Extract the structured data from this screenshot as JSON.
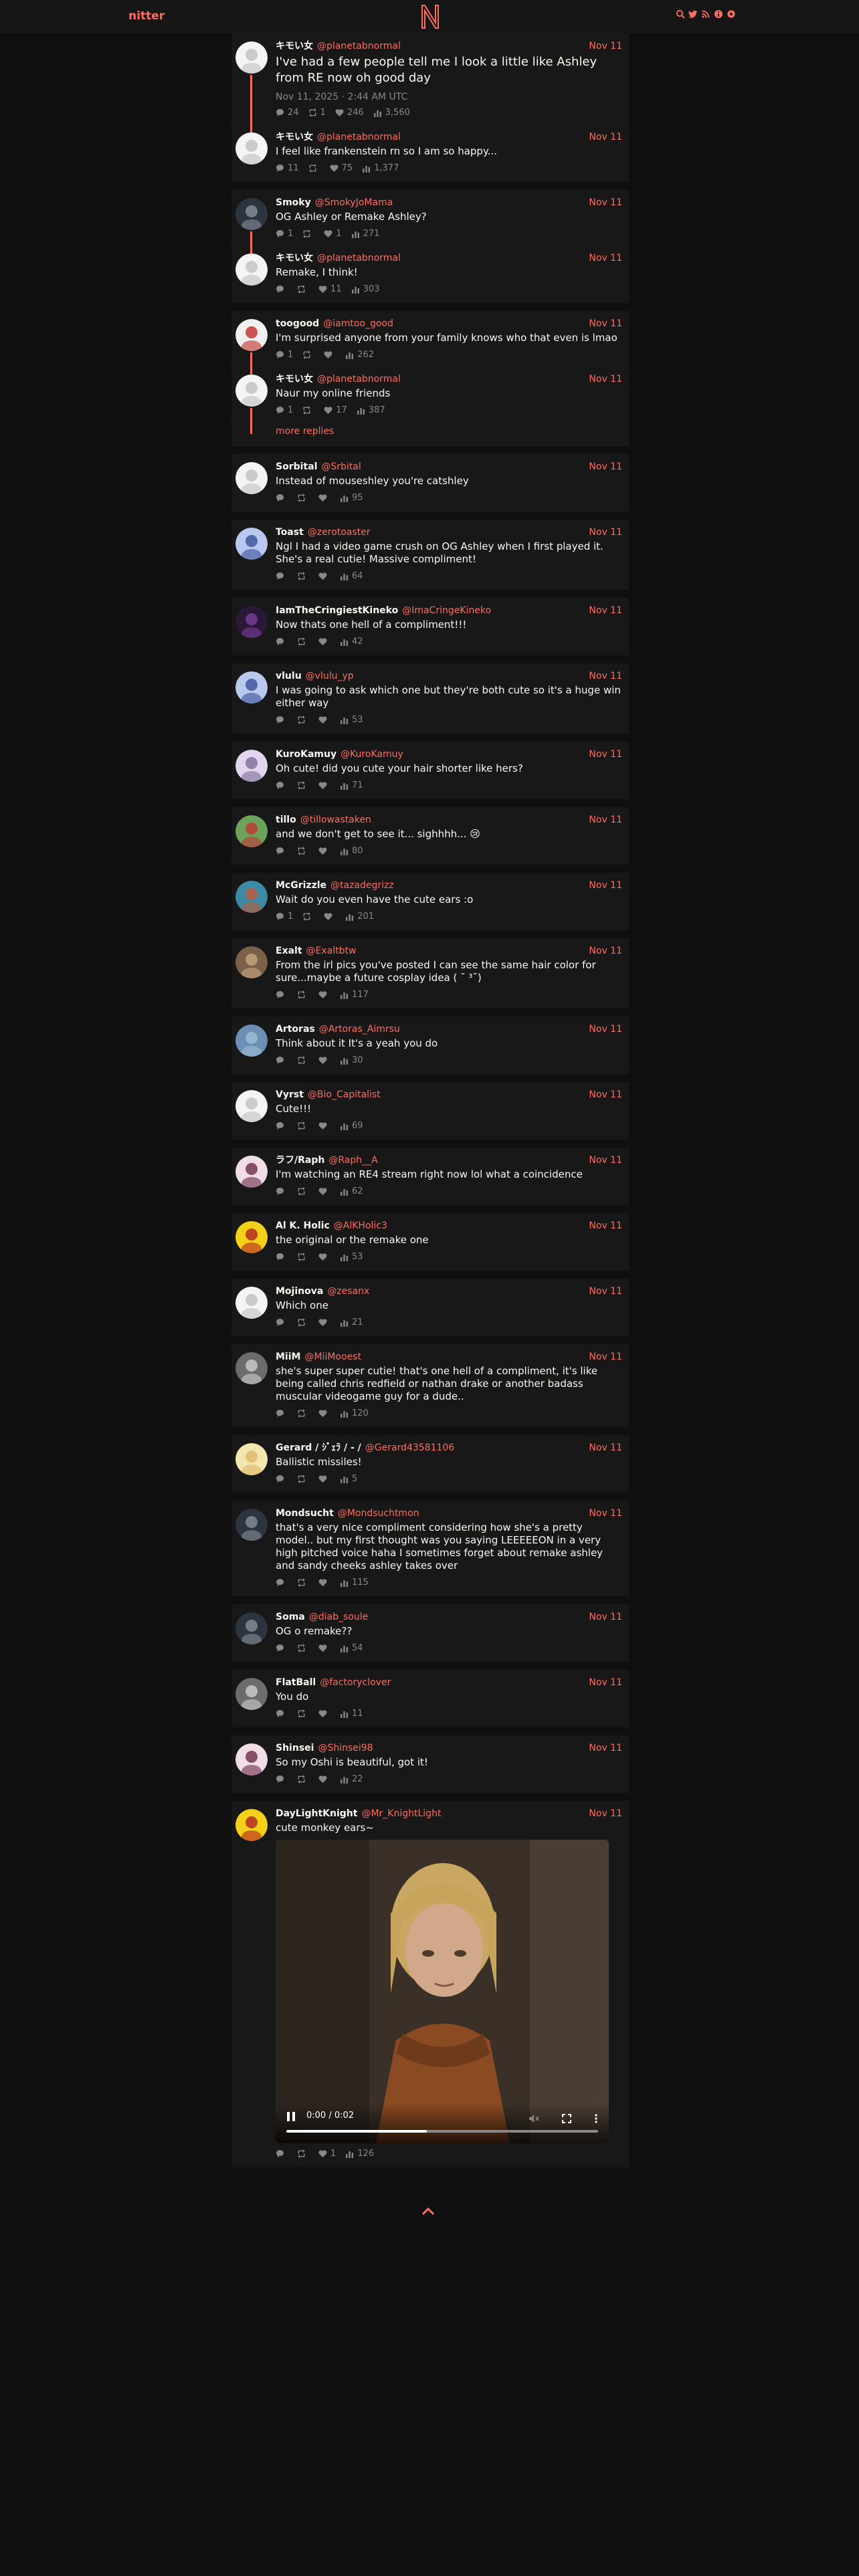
{
  "nav": {
    "brand": "nitter"
  },
  "colors": {
    "accent": "#ff6c60",
    "bg": "#0f0f0f",
    "card": "#181818",
    "muted": "#888888"
  },
  "threads": [
    {
      "tweets": [
        {
          "fullname": "キモい女",
          "username": "@planetabnormal",
          "date": "Nov 11",
          "content": "I've had a few people tell me I look a little like Ashley from RE now oh good day",
          "timestamp": "Nov 11, 2025 · 2:44 AM UTC",
          "replies": "24",
          "retweets": "1",
          "likes": "246",
          "views": "3,560",
          "avatar": "white-avatar"
        },
        {
          "fullname": "キモい女",
          "username": "@planetabnormal",
          "date": "Nov 11",
          "content": "I feel like frankenstein rn so I am so happy...",
          "replies": "11",
          "retweets": "",
          "likes": "75",
          "views": "1,377",
          "avatar": "white-avatar"
        }
      ]
    },
    {
      "tweets": [
        {
          "fullname": "Smoky",
          "username": "@SmokyJoMama",
          "date": "Nov 11",
          "content": "OG Ashley or Remake Ashley?",
          "replies": "1",
          "retweets": "",
          "likes": "1",
          "views": "271",
          "avatar": "dark-avatar"
        },
        {
          "fullname": "キモい女",
          "username": "@planetabnormal",
          "date": "Nov 11",
          "content": "Remake, I think!",
          "replies": "",
          "retweets": "",
          "likes": "11",
          "views": "303",
          "avatar": "white-avatar"
        }
      ]
    },
    {
      "tweets": [
        {
          "fullname": "toogood",
          "username": "@iamtoo_good",
          "date": "Nov 11",
          "content": "I'm surprised anyone from your family knows who that even is lmao",
          "replies": "1",
          "retweets": "",
          "likes": "",
          "views": "262",
          "avatar": "red-avatar"
        },
        {
          "fullname": "キモい女",
          "username": "@planetabnormal",
          "date": "Nov 11",
          "content": "Naur my online friends",
          "replies": "1",
          "retweets": "",
          "likes": "17",
          "views": "387",
          "avatar": "white-avatar"
        }
      ],
      "more_replies": "more replies"
    }
  ],
  "replies": [
    {
      "fullname": "Sorbital",
      "username": "@Srbital",
      "date": "Nov 11",
      "content": "Instead of mouseshley you're catshley",
      "replies": "",
      "retweets": "",
      "likes": "",
      "views": "95",
      "avatar": "white-avatar"
    },
    {
      "fullname": "Toast",
      "username": "@zerotoaster",
      "date": "Nov 11",
      "content": "Ngl I had a video game crush on OG Ashley when I first played it. She's a real cutie! Massive compliment!",
      "replies": "",
      "retweets": "",
      "likes": "",
      "views": "64",
      "avatar": "blue-avatar"
    },
    {
      "fullname": "IamTheCringiestKineko",
      "username": "@ImaCringeKineko",
      "date": "Nov 11",
      "content": "Now thats one hell of a compliment!!!",
      "replies": "",
      "retweets": "",
      "likes": "",
      "views": "42",
      "avatar": "purple-avatar"
    },
    {
      "fullname": "vlulu",
      "username": "@vlulu_yp",
      "date": "Nov 11",
      "content": "I was going to ask which one but they're both cute so it's a huge win either way",
      "replies": "",
      "retweets": "",
      "likes": "",
      "views": "53",
      "avatar": "blue-avatar"
    },
    {
      "fullname": "KuroKamuy",
      "username": "@KuroKamuy",
      "date": "Nov 11",
      "content": "Oh cute! did you cute your hair shorter like hers?",
      "replies": "",
      "retweets": "",
      "likes": "",
      "views": "71",
      "avatar": "lilac-avatar"
    },
    {
      "fullname": "tillo",
      "username": "@tillowastaken",
      "date": "Nov 11",
      "content": "and we don't get to see it... sighhhh... 😢",
      "replies": "",
      "retweets": "",
      "likes": "",
      "views": "80",
      "avatar": "green-avatar"
    },
    {
      "fullname": "McGrizzle",
      "username": "@tazadegrizz",
      "date": "Nov 11",
      "content": "Wait do you even have the cute ears :o",
      "replies": "1",
      "retweets": "",
      "likes": "",
      "views": "201",
      "avatar": "teal-avatar"
    },
    {
      "fullname": "Exalt",
      "username": "@Exaltbtw",
      "date": "Nov 11",
      "content": "From the irl pics you've posted I can see the same hair color for sure...maybe a future cosplay idea ( ˘ ³˘)",
      "replies": "",
      "retweets": "",
      "likes": "",
      "views": "117",
      "avatar": "brown-avatar"
    },
    {
      "fullname": "Artoras",
      "username": "@Artoras_Aimrsu",
      "date": "Nov 11",
      "content": "Think about it It's a yeah you do",
      "replies": "",
      "retweets": "",
      "likes": "",
      "views": "30",
      "avatar": "sky-avatar"
    },
    {
      "fullname": "Vyrst",
      "username": "@Bio_Capitalist",
      "date": "Nov 11",
      "content": "Cute!!!",
      "replies": "",
      "retweets": "",
      "likes": "",
      "views": "69",
      "avatar": "white-avatar"
    },
    {
      "fullname": "ラフ/Raph",
      "username": "@Raph__A",
      "date": "Nov 11",
      "content": "I'm watching an RE4 stream right now lol what a coincidence",
      "replies": "",
      "retweets": "",
      "likes": "",
      "views": "62",
      "avatar": "pink-avatar"
    },
    {
      "fullname": "Al K. Holic",
      "username": "@AlKHolic3",
      "date": "Nov 11",
      "content": "the original or the remake one",
      "replies": "",
      "retweets": "",
      "likes": "",
      "views": "53",
      "avatar": "yellow-avatar"
    },
    {
      "fullname": "Mojinova",
      "username": "@zesanx",
      "date": "Nov 11",
      "content": "Which one",
      "replies": "",
      "retweets": "",
      "likes": "",
      "views": "21",
      "avatar": "white-avatar"
    },
    {
      "fullname": "MiiM",
      "username": "@MiiMooest",
      "date": "Nov 11",
      "content": "she's super super cutie! that's one hell of a compliment, it's like being called chris redfield or nathan drake or another badass muscular videogame guy for a dude..",
      "replies": "",
      "retweets": "",
      "likes": "",
      "views": "120",
      "avatar": "gray-avatar"
    },
    {
      "fullname": "Gerard / ｼﾞｪﾗ / - /",
      "username": "@Gerard43581106",
      "date": "Nov 11",
      "content": "Ballistic missiles!",
      "replies": "",
      "retweets": "",
      "likes": "",
      "views": "5",
      "avatar": "cream-avatar"
    },
    {
      "fullname": "Mondsucht",
      "username": "@Mondsuchtmon",
      "date": "Nov 11",
      "content": "that's a very nice compliment considering how she's a pretty model.. but my first thought was you saying LEEEEEON in a very high pitched voice haha I sometimes forget about remake ashley and sandy cheeks ashley takes over",
      "replies": "",
      "retweets": "",
      "likes": "",
      "views": "115",
      "avatar": "dark-avatar"
    },
    {
      "fullname": "Soma",
      "username": "@diab_soule",
      "date": "Nov 11",
      "content": "OG o remake??",
      "replies": "",
      "retweets": "",
      "likes": "",
      "views": "54",
      "avatar": "dark-avatar"
    },
    {
      "fullname": "FlatBall",
      "username": "@factoryclover",
      "date": "Nov 11",
      "content": "You do",
      "replies": "",
      "retweets": "",
      "likes": "",
      "views": "11",
      "avatar": "gray-avatar"
    },
    {
      "fullname": "Shinsei",
      "username": "@Shinsei98",
      "date": "Nov 11",
      "content": "So my Oshi is beautiful, got it!",
      "replies": "",
      "retweets": "",
      "likes": "",
      "views": "22",
      "avatar": "pink-avatar"
    },
    {
      "fullname": "DayLightKnight",
      "username": "@Mr_KnightLight",
      "date": "Nov 11",
      "content": "cute monkey ears~",
      "replies": "",
      "retweets": "",
      "likes": "1",
      "views": "126",
      "avatar": "yellow-avatar",
      "video": {
        "time": "0:00 / 0:02",
        "progress": 0.45
      }
    }
  ]
}
